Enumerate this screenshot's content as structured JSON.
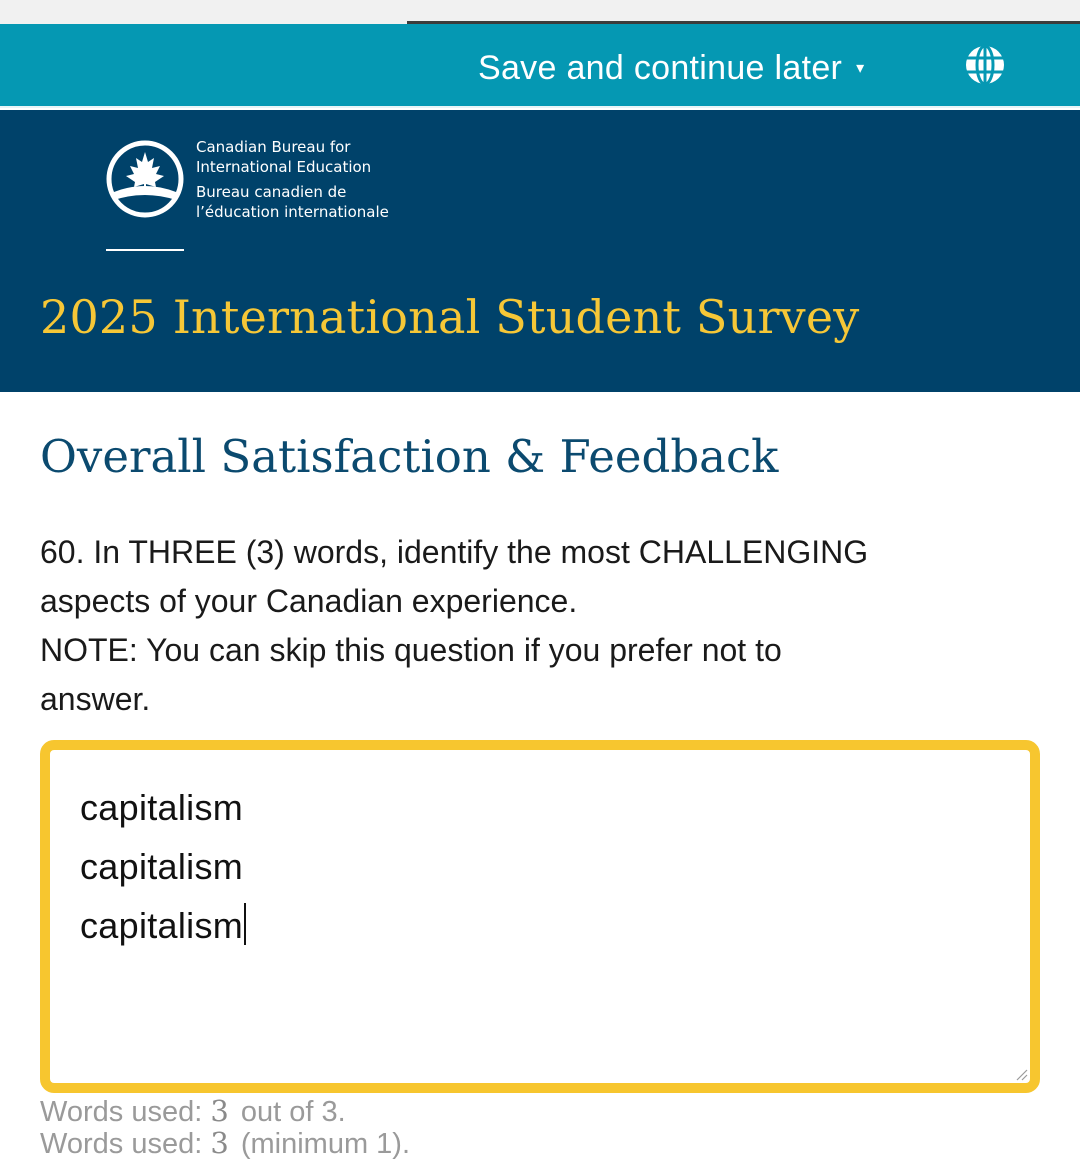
{
  "toolbar": {
    "save_label": "Save and continue later",
    "save_caret": "▾",
    "language_icon": "globe-icon"
  },
  "brand": {
    "org_en_line1": "Canadian Bureau for",
    "org_en_line2": "International Education",
    "org_fr_line1": "Bureau canadien de",
    "org_fr_line2": "l’éducation internationale",
    "logo_icon": "maple-leaf-logo-icon"
  },
  "header": {
    "survey_title": "2025 International Student Survey"
  },
  "section": {
    "title": "Overall Satisfaction & Feedback"
  },
  "question": {
    "line1": "60. In THREE (3) words, identify the most CHALLENGING",
    "line2": "aspects of your Canadian experience.",
    "line3": "NOTE: You can skip this question if you prefer not to",
    "line4": "answer."
  },
  "answer": {
    "lines": [
      "capitalism",
      "capitalism",
      "capitalism"
    ]
  },
  "counters": {
    "words_used_label": "Words used:",
    "words_used_count": "3",
    "out_of_text": "out of 3.",
    "minimum_text": "(minimum 1)."
  },
  "colors": {
    "toolbar_bg": "#0598b3",
    "header_bg": "#00426a",
    "title_gold": "#f6c737",
    "section_blue": "#0b4a6f",
    "focus_outline": "#f7c62f"
  }
}
